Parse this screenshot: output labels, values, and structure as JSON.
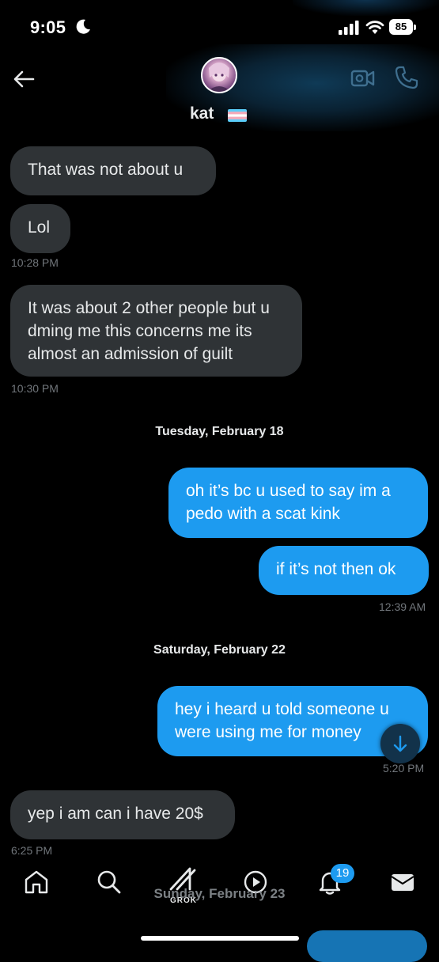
{
  "status_bar": {
    "time": "9:05",
    "battery": "85"
  },
  "header": {
    "contact_name": "kat"
  },
  "messages": [
    {
      "text": "That was not about u"
    },
    {
      "text": "Lol",
      "time": "10:28 PM"
    },
    {
      "text": "It was about 2 other people but u dming me this concerns me its almost an admission of guilt",
      "time": "10:30 PM"
    },
    {
      "date": "Tuesday, February 18"
    },
    {
      "text": "oh it’s bc u used to say im a pedo with a scat kink"
    },
    {
      "text": "if it’s not then ok",
      "time": "12:39 AM"
    },
    {
      "date": "Saturday, February 22"
    },
    {
      "text": "hey i heard u told someone u were using me for money",
      "time": "5:20 PM"
    },
    {
      "text": "yep i am can i have 20$",
      "time": "6:25 PM"
    },
    {
      "date": "Sunday, February 23"
    }
  ],
  "bottom_nav": {
    "items": [
      "home-icon",
      "search-icon",
      "grok-icon",
      "video-icon",
      "notifications-icon",
      "messages-icon"
    ],
    "grok_label": "GROK",
    "notifications_badge": "19"
  },
  "colors": {
    "background": "#000000",
    "incoming_bubble": "#2f3336",
    "outgoing_bubble": "#1d9bf0",
    "timestamp": "#71767b",
    "accent": "#1d9bf0"
  }
}
